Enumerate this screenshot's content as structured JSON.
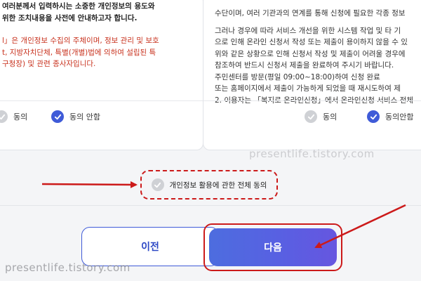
{
  "left_panel": {
    "lines": [
      {
        "text": "여러분께서 입력하시는 소중한 개인정보의 용도와",
        "style": "bold"
      },
      {
        "text": "위한 조치내용을 사전에 안내하고자 합니다.",
        "style": "bold"
      },
      {
        "text": "",
        "style": "normal"
      },
      {
        "text": "l」은 개인정보 수집의 주체이며, 정보 관리 및 보호",
        "style": "red"
      },
      {
        "text": "t, 지방자치단체, 특별(개별)법에 의하여 설립된 특",
        "style": "red"
      },
      {
        "text": "구청장) 및 관련 종사자입니다.",
        "style": "red"
      }
    ],
    "option_agree": "동의",
    "option_disagree": "동의 안함",
    "selected": "disagree"
  },
  "right_panel": {
    "lines": [
      {
        "text": "수단이며, 여러 기관과의 연계를 통해 신청에 필요한 각종 정보",
        "style": "normal"
      },
      {
        "text": "",
        "style": "normal"
      },
      {
        "text": "그러나 경우에 따라 서비스 개선을 위한 시스템 작업 및 타 기",
        "style": "normal"
      },
      {
        "text": "으로 인해 온라인 신청서 작성 또는 제출이 용이하지 않을 수 있",
        "style": "normal"
      },
      {
        "text": "위와 같은 상황으로 인해 신청서 작성 및 제출이 어려울 경우에",
        "style": "normal"
      },
      {
        "text": "참조하여 반드시 신청서 제출을 완료하여 주시기 바랍니다.",
        "style": "normal"
      },
      {
        "text": "주민센터를 방문(평일 09:00~18:00)하여 신청 완료",
        "style": "normal"
      },
      {
        "text": "또는 홈페이지에서 제출이 가능하게 되었을 때 재시도하여 제",
        "style": "normal"
      },
      {
        "text": "2. 이용자는 「복지로 온라인신청」에서 온라인신청 서비스 전체",
        "style": "normal"
      }
    ],
    "option_agree": "동의",
    "option_disagree": "동의안함",
    "selected": "disagree"
  },
  "overall_consent": {
    "label": "개인정보 활용에 관한 전체 동의",
    "checked": false
  },
  "buttons": {
    "prev": "이전",
    "next": "다음"
  },
  "watermarks": {
    "top": "presentlife.tistory.com",
    "bottom": "presentlife.tistory.com"
  },
  "colors": {
    "accent": "#3f5bd8",
    "annotation_red": "#cc1a1a",
    "disabled_gray": "#cfd1d5"
  }
}
